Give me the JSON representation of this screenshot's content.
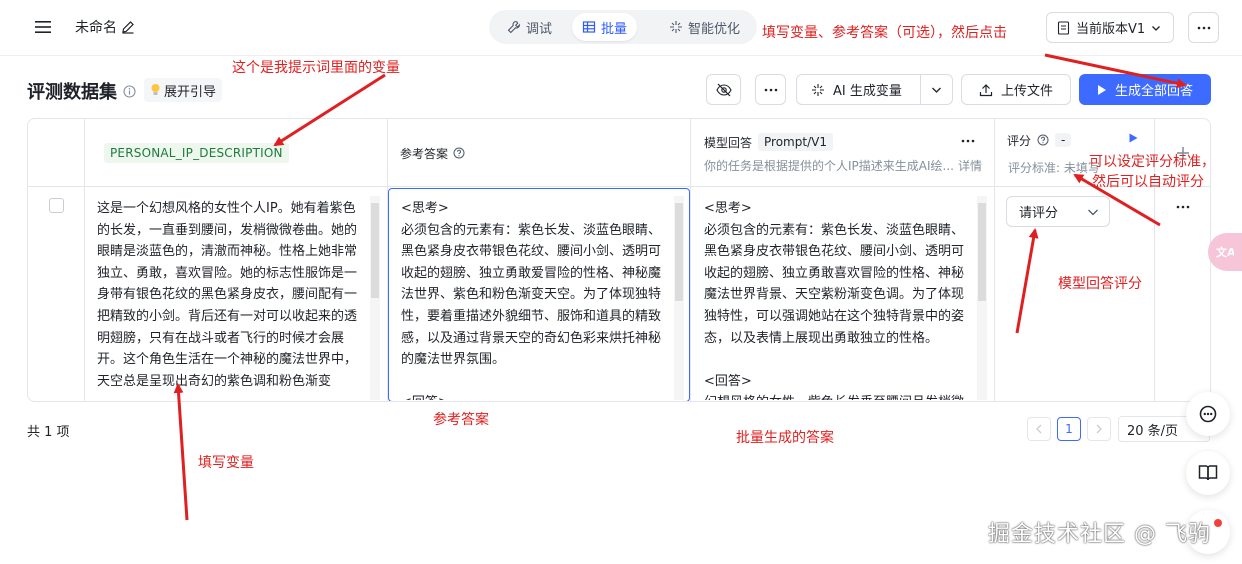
{
  "topbar": {
    "title": "未命名",
    "tabs": [
      {
        "label": "调试",
        "icon": "wrench-icon"
      },
      {
        "label": "批量",
        "icon": "table-icon"
      },
      {
        "label": "智能优化",
        "icon": "sparkle-icon"
      }
    ],
    "active_tab": "批量",
    "version_label": "当前版本V1"
  },
  "section": {
    "title": "评测数据集",
    "guide_label": "展开引导",
    "buttons": {
      "ai_generate": "AI 生成变量",
      "upload": "上传文件",
      "generate_all": "生成全部回答"
    }
  },
  "table": {
    "headers": {
      "variable": "PERSONAL_IP_DESCRIPTION",
      "reference": "参考答案",
      "model_answer": "模型回答",
      "prompt_tag": "Prompt/V1",
      "prompt_desc": "你的任务是根据提供的个人IP描述来生成AI绘...",
      "detail": "详情",
      "score": "评分",
      "score_badge": "-",
      "score_standard": "评分标准: 未填写"
    },
    "rows": [
      {
        "variable": "这是一个幻想风格的女性个人IP。她有着紫色的长发，一直垂到腰间，发梢微微卷曲。她的眼睛是淡蓝色的，清澈而神秘。性格上她非常独立、勇敢，喜欢冒险。她的标志性服饰是一身带有银色花纹的黑色紧身皮衣，腰间配有一把精致的小剑。背后还有一对可以收起来的透明翅膀，只有在战斗或者飞行的时候才会展开。这个角色生活在一个神秘的魔法世界中，天空总是呈现出奇幻的紫色调和粉色渐变",
        "reference": "<思考>\n必须包含的元素有：紫色长发、淡蓝色眼睛、黑色紧身皮衣带银色花纹、腰间小剑、透明可收起的翅膀、独立勇敢爱冒险的性格、神秘魔法世界、紫色和粉色渐变天空。为了体现独特性，要着重描述外貌细节、服饰和道具的精致感，以及通过背景天空的奇幻色彩来烘托神秘的魔法世界氛围。\n\n<回答>",
        "model_answer": "<思考>\n必须包含的元素有：紫色长发、淡蓝色眼睛、黑色紧身皮衣带银色花纹、腰间小剑、透明可收起的翅膀、独立勇敢喜欢冒险的性格、神秘魔法世界背景、天空紫粉渐变色调。为了体现独特性，可以强调她站在这个独特背景中的姿态，以及表情上展现出勇敢独立的性格。\n\n<回答>\n幻想风格的女性，紫色长发垂至腰间且发梢微卷",
        "score_placeholder": "请评分"
      }
    ]
  },
  "pagination": {
    "total": "共 1 项",
    "page": "1",
    "page_size": "20 条/页"
  },
  "annotations": {
    "a1": "这个是我提示词里面的变量",
    "a2": "填写变量、参考答案（可选），然后点击",
    "a3": "可以设定评分标准，",
    "a3b": "然后可以自动评分",
    "a4": "模型回答评分",
    "a5": "参考答案",
    "a6": "批量生成的答案",
    "a7": "填写变量"
  },
  "watermark": "掘金技术社区 @ 飞驹",
  "colors": {
    "primary": "#3d6bff",
    "annotation": "#e02020",
    "var_tag_bg": "#eef7ee"
  }
}
